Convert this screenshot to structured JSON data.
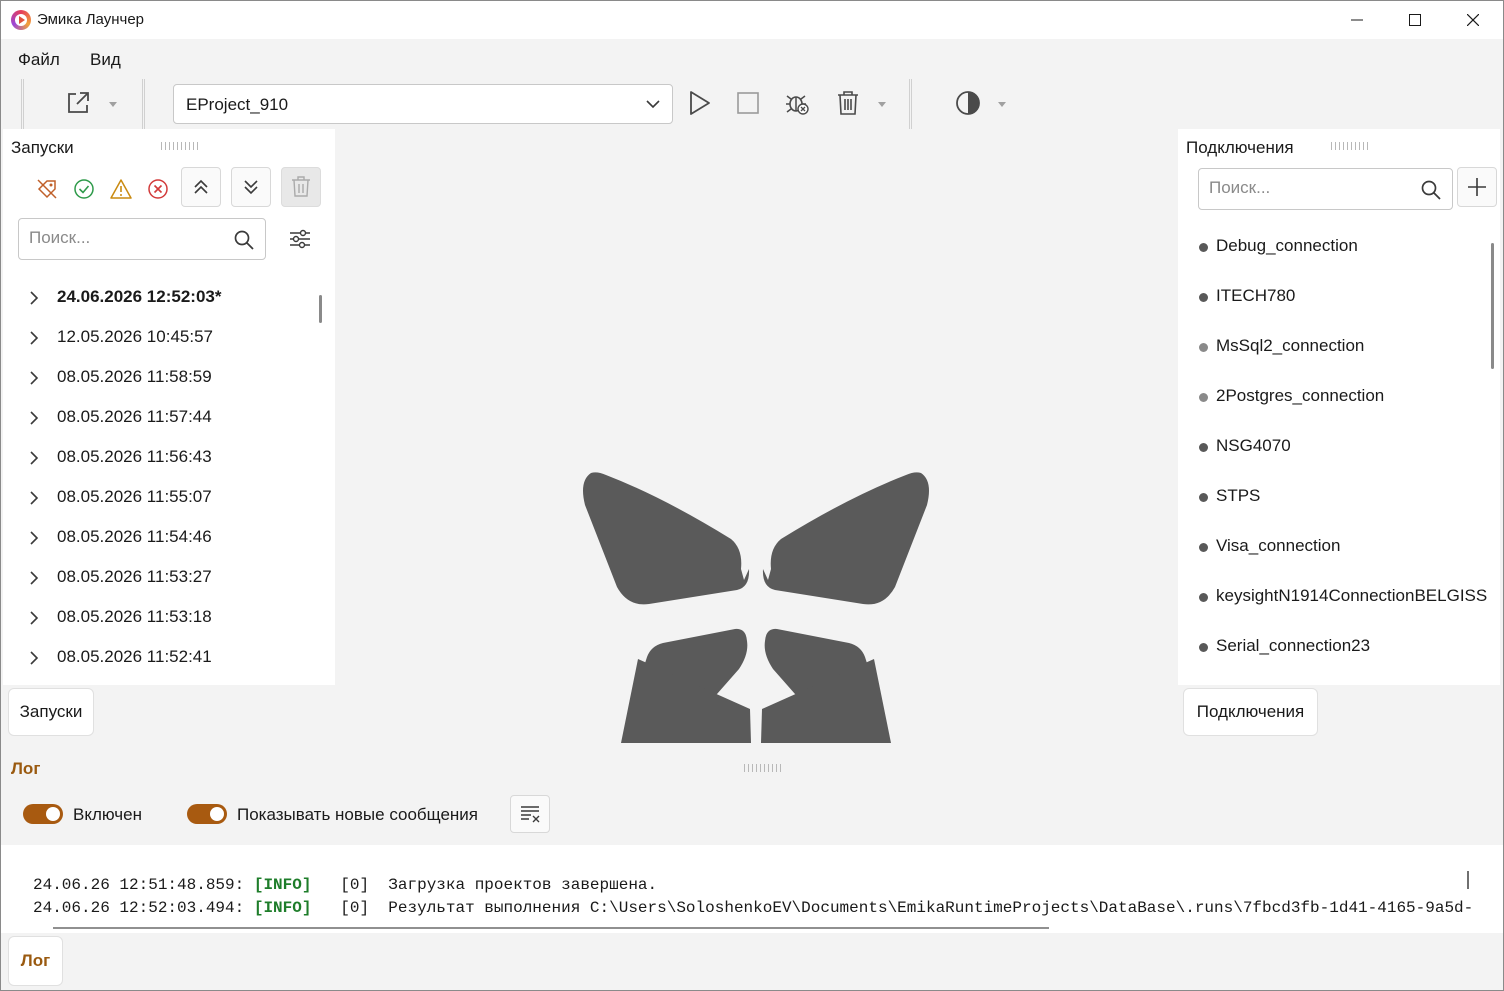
{
  "window": {
    "title": "Эмика Лаунчер"
  },
  "menu": {
    "items": [
      "Файл",
      "Вид"
    ]
  },
  "toolbar": {
    "project": "EProject_910"
  },
  "runs_panel": {
    "title": "Запуски",
    "search_placeholder": "Поиск...",
    "tab_label": "Запуски",
    "runs": [
      {
        "date": "24.06.2026 12:52:03*",
        "current": true
      },
      {
        "date": "12.05.2026 10:45:57",
        "current": false
      },
      {
        "date": "08.05.2026 11:58:59",
        "current": false
      },
      {
        "date": "08.05.2026 11:57:44",
        "current": false
      },
      {
        "date": "08.05.2026 11:56:43",
        "current": false
      },
      {
        "date": "08.05.2026 11:55:07",
        "current": false
      },
      {
        "date": "08.05.2026 11:54:46",
        "current": false
      },
      {
        "date": "08.05.2026 11:53:27",
        "current": false
      },
      {
        "date": "08.05.2026 11:53:18",
        "current": false
      },
      {
        "date": "08.05.2026 11:52:41",
        "current": false
      }
    ]
  },
  "connections_panel": {
    "title": "Подключения",
    "search_placeholder": "Поиск...",
    "tab_label": "Подключения",
    "connections": [
      {
        "name": "Debug_connection",
        "status": "dark"
      },
      {
        "name": "ITECH780",
        "status": "dark"
      },
      {
        "name": "MsSql2_connection",
        "status": "grey"
      },
      {
        "name": "2Postgres_connection",
        "status": "grey"
      },
      {
        "name": "NSG4070",
        "status": "dark"
      },
      {
        "name": "STPS",
        "status": "dark"
      },
      {
        "name": "Visa_connection",
        "status": "dark"
      },
      {
        "name": "keysightN1914ConnectionBELGISS",
        "status": "dark"
      },
      {
        "name": "Serial_connection23",
        "status": "dark"
      }
    ]
  },
  "log": {
    "title": "Лог",
    "tab_label": "Лог",
    "toggle_enabled_label": "Включен",
    "toggle_enabled": true,
    "toggle_show_new_label": "Показывать новые сообщения",
    "toggle_show_new": true,
    "lines": [
      {
        "time": "24.06.26 12:51:48.859:",
        "level": "[INFO]",
        "thread": "[0]",
        "message": "Загрузка проектов завершена."
      },
      {
        "time": "24.06.26 12:52:03.494:",
        "level": "[INFO]",
        "thread": "[0]",
        "message": "Результат выполнения C:\\Users\\SoloshenkoEV\\Documents\\EmikaRuntimeProjects\\DataBase\\.runs\\7fbcd3fb-1d41-4165-9a5d-"
      }
    ]
  },
  "colors": {
    "accent": "#a85a10",
    "log_title": "#9a5a10",
    "info_level": "#1e7d2a",
    "logo": "#5a5a5a",
    "success": "#2e9a4a",
    "warning": "#c98a10",
    "error": "#d23a3a"
  }
}
